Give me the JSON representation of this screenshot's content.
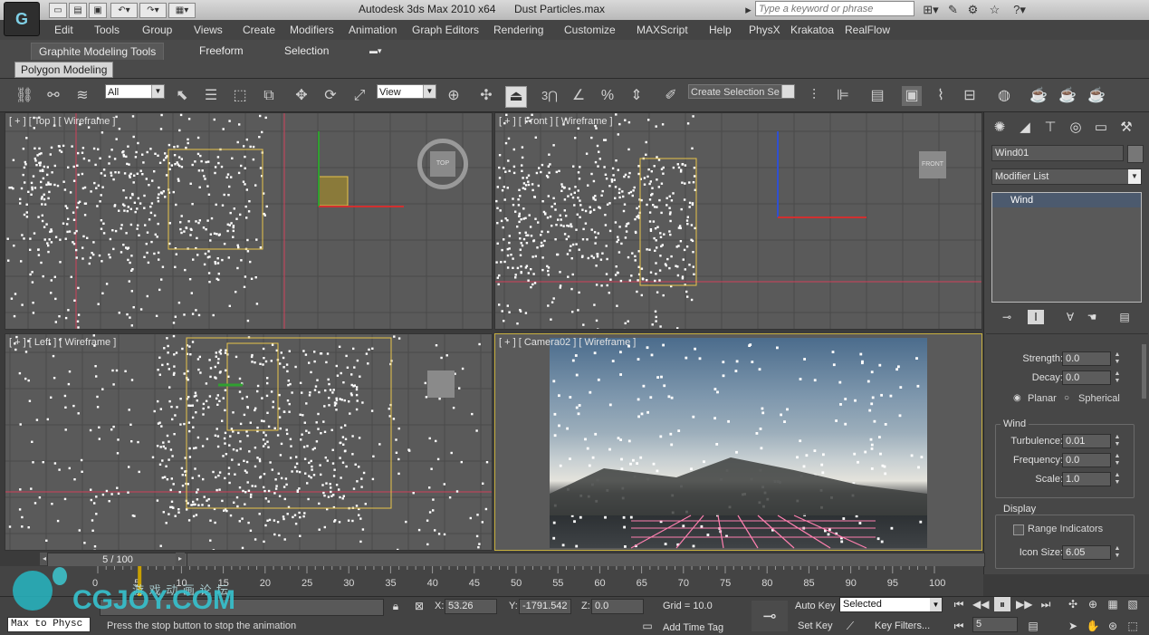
{
  "window": {
    "app_title": "Autodesk 3ds Max  2010 x64",
    "file_name": "Dust Particles.max",
    "search_placeholder": "Type a keyword or phrase"
  },
  "menu": [
    "Edit",
    "Tools",
    "Group",
    "Views",
    "Create",
    "Modifiers",
    "Animation",
    "Graph Editors",
    "Rendering",
    "Customize",
    "MAXScript",
    "Help",
    "PhysX",
    "Krakatoa",
    "RealFlow"
  ],
  "ribbon": {
    "tabs": [
      "Graphite Modeling Tools",
      "Freeform",
      "Selection"
    ],
    "sub_tab": "Polygon Modeling"
  },
  "toolbar": {
    "selection_filter": "All",
    "ref_coord": "View",
    "named_selection": "Create Selection Se",
    "snap_label": "3"
  },
  "viewports": {
    "top": {
      "label": "[ + ] [ Top ] [ Wireframe ]",
      "cube": "TOP"
    },
    "front": {
      "label": "[ + ] [ Front ] [ Wireframe ]",
      "cube": "FRONT"
    },
    "left": {
      "label": "[ + ] [ Left ] [ Wireframe ]"
    },
    "camera": {
      "label": "[ + ] [ Camera02 ] [ Wireframe ]"
    }
  },
  "command_panel": {
    "object_name": "Wind01",
    "modifier_list": "Modifier List",
    "stack_item": "Wind",
    "strength_label": "Strength:",
    "strength": "0.0",
    "decay_label": "Decay:",
    "decay": "0.0",
    "planar": "Planar",
    "spherical": "Spherical",
    "wind_group": "Wind",
    "turbulence_label": "Turbulence:",
    "turbulence": "0.01",
    "frequency_label": "Frequency:",
    "frequency": "0.0",
    "scale_label": "Scale:",
    "scale": "1.0",
    "display_group": "Display",
    "range_indicators": "Range Indicators",
    "icon_size_label": "Icon Size:",
    "icon_size": "6.05"
  },
  "timeline": {
    "slider": "5 / 100",
    "ticks": [
      "0",
      "5",
      "10",
      "15",
      "20",
      "25",
      "30",
      "35",
      "40",
      "45",
      "50",
      "55",
      "60",
      "65",
      "70",
      "75",
      "80",
      "85",
      "90",
      "95",
      "100"
    ]
  },
  "status": {
    "maxscript_listener": "Max to Physc",
    "prompt": "Press the stop button to stop the animation",
    "x_label": "X:",
    "x": "53.26",
    "y_label": "Y:",
    "y": "-1791.542",
    "z_label": "Z:",
    "z": "0.0",
    "grid": "Grid = 10.0",
    "add_time_tag": "Add Time Tag",
    "auto_key": "Auto Key",
    "set_key": "Set Key",
    "key_mode": "Selected",
    "key_filters": "Key Filters...",
    "current_frame": "5"
  },
  "watermark": {
    "cn": "游 戏 动 画 论 坛",
    "brand": "CGJOY.COM"
  },
  "colors": {
    "viewport_bg": "#5a5a5a",
    "grid": "#4a4a4a",
    "axis_red": "#d0405a",
    "gizmo_yellow": "#e8c44a",
    "particle": "#ffffff"
  }
}
